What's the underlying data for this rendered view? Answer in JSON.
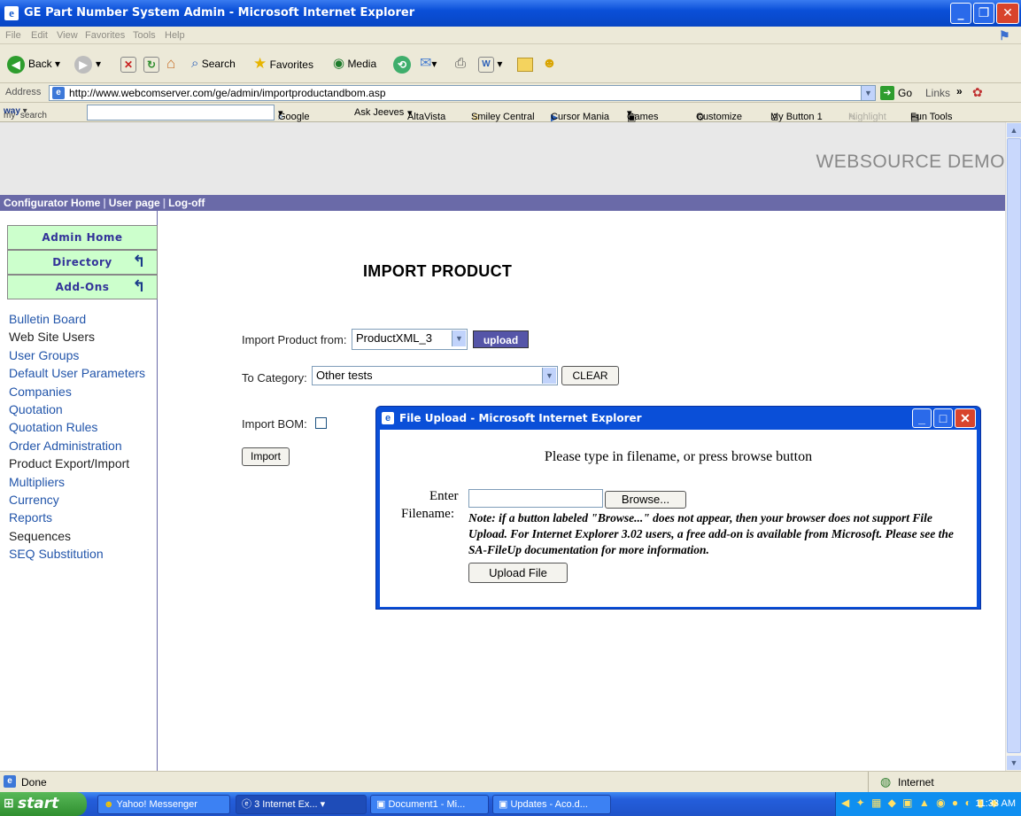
{
  "window": {
    "title": "GE Part Number System Admin - Microsoft Internet Explorer"
  },
  "menu": [
    "File",
    "Edit",
    "View",
    "Favorites",
    "Tools",
    "Help"
  ],
  "toolbar": {
    "back": "Back",
    "search": "Search",
    "favorites": "Favorites",
    "media": "Media"
  },
  "address": {
    "label": "Address",
    "url": "http://www.webcomserver.com/ge/admin/importproductandbom.asp",
    "go": "Go",
    "links": "Links"
  },
  "searchbar": {
    "brand_my": "my",
    "brand_way": "way",
    "brand_search": "search",
    "items": [
      "Google",
      "Ask Jeeves",
      "AltaVista",
      "Smiley Central",
      "Cursor Mania",
      "Games",
      "Customize",
      "My Button 1",
      "Highlight",
      "Fun Tools"
    ]
  },
  "page": {
    "brand": "WEBSOURCE DEMO",
    "nav": [
      "Configurator Home",
      "User page",
      "Log-off"
    ],
    "sidebar_buttons": [
      "Admin Home",
      "Directory",
      "Add-Ons"
    ],
    "sidebar_links": [
      "Bulletin Board",
      "Web Site Users",
      "User Groups",
      "Default User Parameters",
      "Companies",
      "Quotation",
      "Quotation Rules",
      "Order Administration",
      "Product Export/Import",
      "Multipliers",
      "Currency",
      "Reports",
      "Sequences",
      "SEQ Substitution"
    ],
    "title": "IMPORT PRODUCT",
    "import_from_label": "Import Product from:",
    "import_from_value": "ProductXML_3",
    "upload_label": "upload",
    "category_label": "To Category:",
    "category_value": "Other tests",
    "clear_label": "CLEAR",
    "import_bom_label": "Import BOM:",
    "import_button": "Import"
  },
  "dialog": {
    "title": "File Upload - Microsoft Internet Explorer",
    "instruction": "Please type in filename, or press browse button",
    "enter_label": "Enter",
    "filename_label": "Filename:",
    "browse": "Browse...",
    "note": "Note: if a button labeled \"Browse...\" does not appear, then your browser does not support File Upload. For Internet Explorer 3.02 users, a free add-on is available from Microsoft. Please see the SA-FileUp documentation for more information.",
    "upload_file": "Upload File"
  },
  "status": {
    "text": "Done",
    "zone": "Internet"
  },
  "taskbar": {
    "start": "start",
    "tasks": [
      "Yahoo! Messenger",
      "3 Internet Ex...",
      "Document1 - Mi...",
      "Updates - Aco.d..."
    ],
    "clock": "11:33 AM"
  }
}
